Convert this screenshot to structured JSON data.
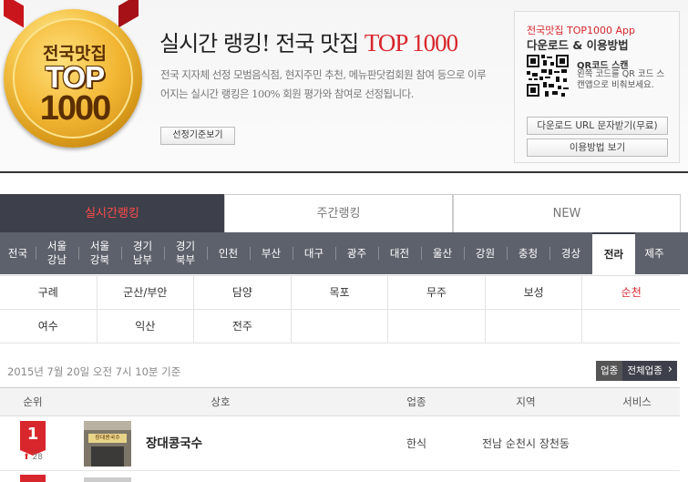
{
  "header": {
    "medal": {
      "line1": "전국맛집",
      "line2": "TOP",
      "line3": "1000"
    },
    "title_main": "실시간 랭킹! 전국 맛집",
    "title_accent": "TOP 1000",
    "description": "전국 지자체 선정 모범음식점, 현지주민 추천, 메뉴판닷컴회원 참여 등으로 이루어지는 실시간 랭킹은 100% 회원 평가와 참여로 선정됩니다.",
    "criteria_button": "선정기준보기"
  },
  "app_box": {
    "title": "전국맛집 TOP1000 App",
    "subtitle": "다운로드 & 이용방법",
    "qr_label": "QR코드 스캔",
    "qr_desc": "왼쪽 코드를 QR 코드 스캔앱으로 비춰보세요.",
    "sms_button": "다운로드 URL 문자받기(무료)",
    "howto_button": "이용방법 보기"
  },
  "tabs": [
    {
      "label": "실시간랭킹",
      "active": true
    },
    {
      "label": "주간랭킹",
      "active": false
    },
    {
      "label": "NEW",
      "active": false
    }
  ],
  "regions": [
    {
      "label": "전국"
    },
    {
      "label": "서울 강남"
    },
    {
      "label": "서울 강북"
    },
    {
      "label": "경기 남부"
    },
    {
      "label": "경기 북부"
    },
    {
      "label": "인천"
    },
    {
      "label": "부산"
    },
    {
      "label": "대구"
    },
    {
      "label": "광주"
    },
    {
      "label": "대전"
    },
    {
      "label": "울산"
    },
    {
      "label": "강원"
    },
    {
      "label": "충청"
    },
    {
      "label": "경상"
    },
    {
      "label": "전라",
      "active": true
    },
    {
      "label": "제주"
    }
  ],
  "subregions": [
    {
      "label": "구례"
    },
    {
      "label": "군산/부안"
    },
    {
      "label": "담양"
    },
    {
      "label": "목포"
    },
    {
      "label": "무주"
    },
    {
      "label": "보성"
    },
    {
      "label": "순천",
      "active": true
    },
    {
      "label": "여수"
    },
    {
      "label": "익산"
    },
    {
      "label": "전주"
    },
    {
      "label": ""
    },
    {
      "label": ""
    },
    {
      "label": ""
    },
    {
      "label": ""
    }
  ],
  "timestamp": "2015년 7월 20일 오전 7시 10분 기준",
  "filter": {
    "label": "업종",
    "all": "전체업종"
  },
  "table": {
    "headers": {
      "rank": "순위",
      "name": "상호",
      "category": "업종",
      "region": "지역",
      "service": "서비스"
    },
    "rows": [
      {
        "rank": "1",
        "change": "28",
        "thumb_sign": "장대콩국수",
        "name": "장대콩국수",
        "category": "한식",
        "region": "전남 순천시 장천동",
        "service": ""
      }
    ]
  },
  "colors": {
    "accent": "#d8262d",
    "dark": "#3d404a",
    "region_bar": "#5d616b"
  }
}
